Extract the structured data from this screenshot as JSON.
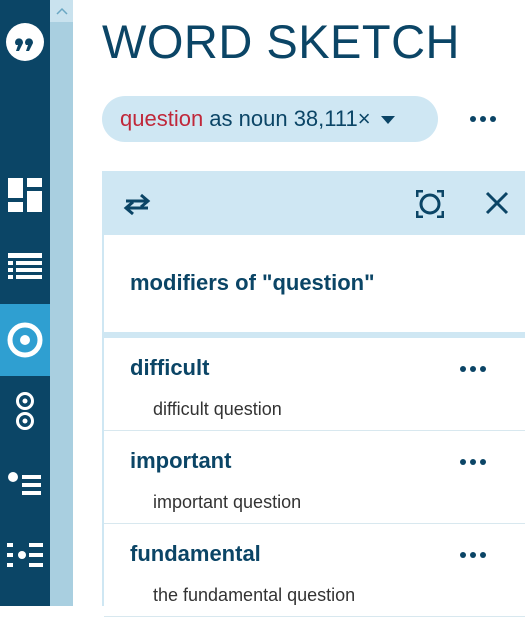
{
  "app": {
    "title": "WORD SKETCH"
  },
  "sidebar": {
    "items": [
      {
        "name": "logo",
        "icon": "quote-icon"
      },
      {
        "name": "dashboard",
        "icon": "dashboard-icon"
      },
      {
        "name": "list",
        "icon": "list-icon"
      },
      {
        "name": "word-sketch",
        "icon": "target-icon",
        "active": true
      },
      {
        "name": "compare",
        "icon": "double-circle-icon"
      },
      {
        "name": "bullet-list",
        "icon": "bullet-list-icon"
      },
      {
        "name": "grid-list",
        "icon": "grid-list-icon"
      }
    ]
  },
  "query": {
    "lemma": "question",
    "pos_text": " as noun 38,111×"
  },
  "panel": {
    "title": "modifiers of \"question\"",
    "rows": [
      {
        "word": "difficult",
        "example": "difficult question"
      },
      {
        "word": "important",
        "example": "important question"
      },
      {
        "word": "fundamental",
        "example": "the fundamental question"
      }
    ]
  },
  "colors": {
    "sidebar": "#0b4566",
    "active": "#2f9fd1",
    "strip": "#a9cfe0",
    "pill": "#cfe7f3",
    "lemma": "#c0283a",
    "text": "#0b4566"
  }
}
